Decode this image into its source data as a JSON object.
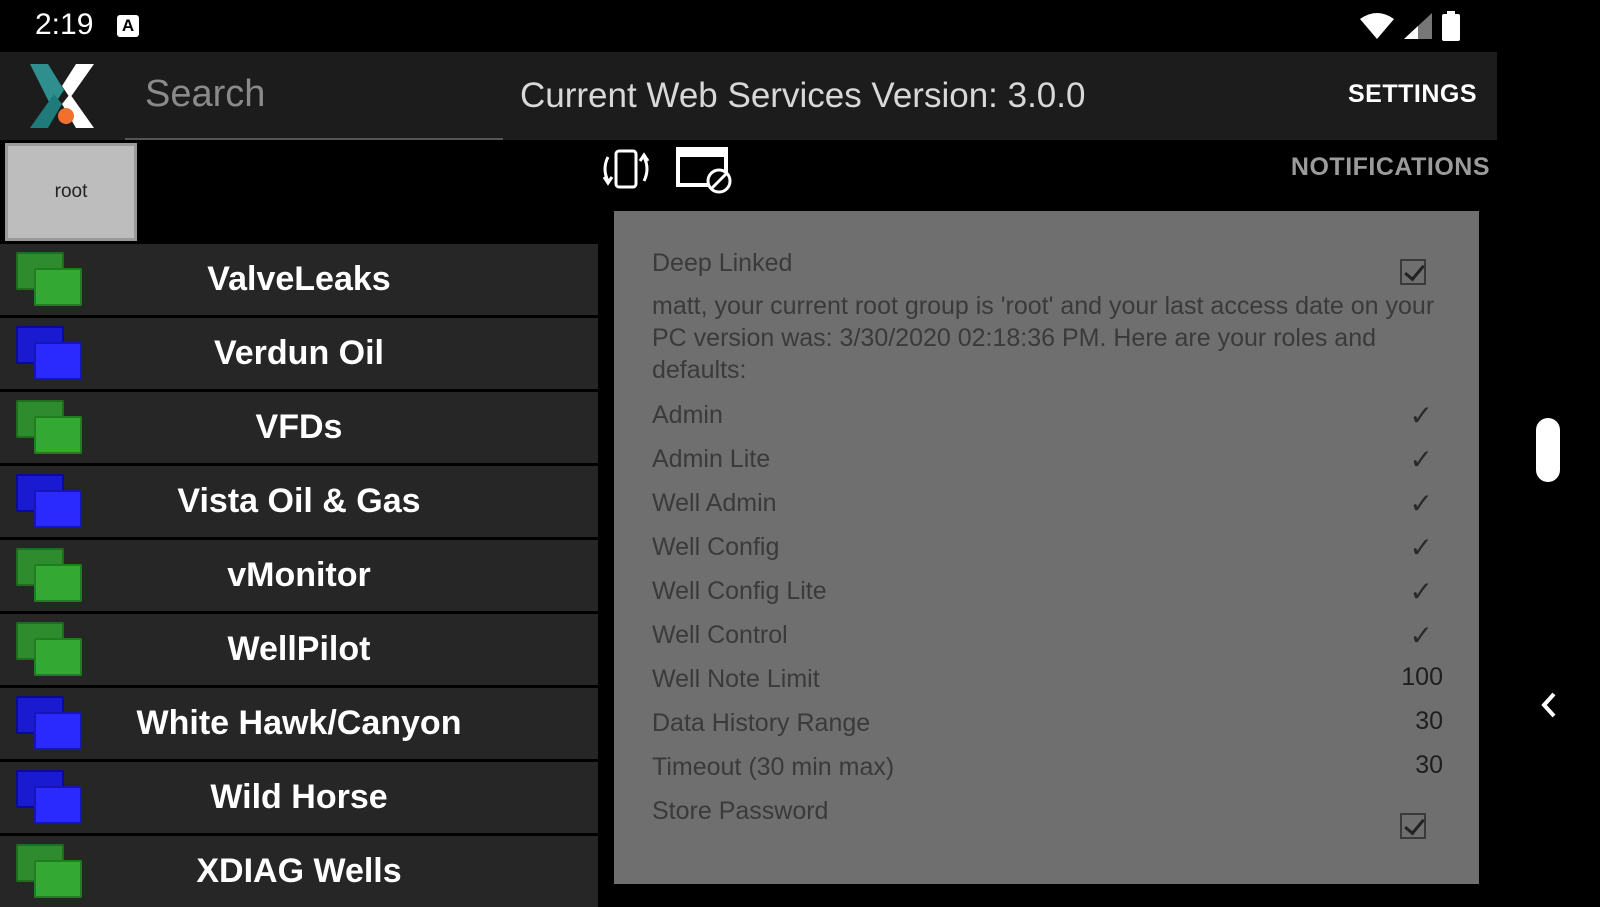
{
  "status_bar": {
    "time": "2:19",
    "notification_icon": "A"
  },
  "app_bar": {
    "logo_icon": "x-logo-icon",
    "search_placeholder": "Search",
    "version_text": "Current Web Services Version: 3.0.0",
    "settings_label": "SETTINGS"
  },
  "root_button": {
    "label": "root"
  },
  "actions": {
    "rotate_icon": "screen-rotation-icon",
    "screen_icon": "screen-lock-icon",
    "notifications_label": "NOTIFICATIONS"
  },
  "groups": [
    {
      "label": "ValveLeaks",
      "color": "green"
    },
    {
      "label": "Verdun Oil",
      "color": "blue"
    },
    {
      "label": "VFDs",
      "color": "green"
    },
    {
      "label": "Vista Oil & Gas",
      "color": "blue"
    },
    {
      "label": "vMonitor",
      "color": "green"
    },
    {
      "label": "WellPilot",
      "color": "green"
    },
    {
      "label": "White Hawk/Canyon",
      "color": "blue"
    },
    {
      "label": "Wild Horse",
      "color": "blue"
    },
    {
      "label": "XDIAG Wells",
      "color": "green"
    }
  ],
  "info": {
    "deep_linked_label": "Deep Linked",
    "deep_linked_checked": true,
    "message": "matt, your current root group is 'root' and your last access date on your PC version was: 3/30/2020 02:18:36 PM.  Here are your roles and defaults:",
    "roles": [
      {
        "name": "Admin",
        "value": "✓"
      },
      {
        "name": "Admin Lite",
        "value": "✓"
      },
      {
        "name": "Well Admin",
        "value": "✓"
      },
      {
        "name": "Well Config",
        "value": "✓"
      },
      {
        "name": "Well Config Lite",
        "value": "✓"
      },
      {
        "name": "Well Control",
        "value": "✓"
      },
      {
        "name": "Well Note Limit",
        "value": "100"
      },
      {
        "name": "Data History Range",
        "value": "30"
      },
      {
        "name": "Timeout (30 min max)",
        "value": "30"
      }
    ],
    "store_password_label": "Store Password",
    "store_password_checked": true
  },
  "colors": {
    "panel_bg": "#6f6f6f",
    "list_bg": "#262626",
    "green": "#33a833",
    "blue": "#2a2aff"
  }
}
